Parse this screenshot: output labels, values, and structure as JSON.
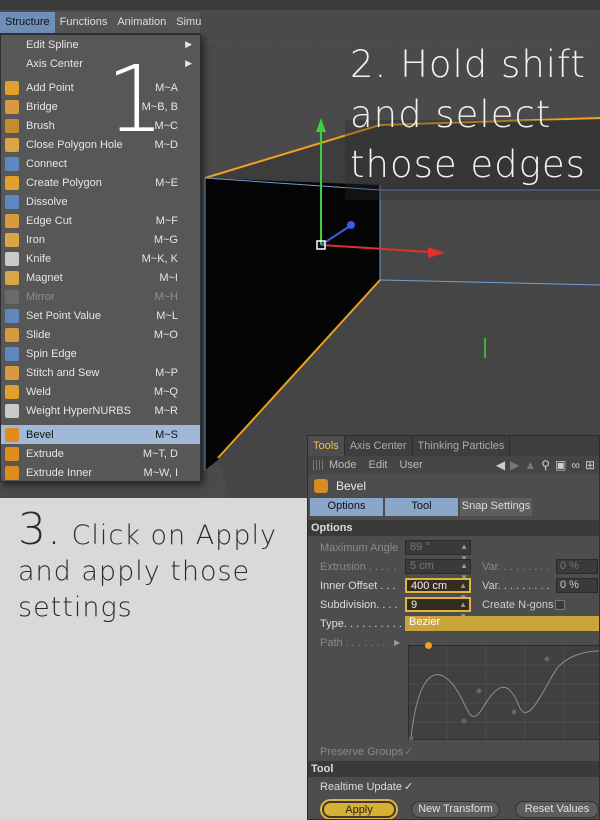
{
  "overlays": {
    "step1": "1",
    "step2": "2. Hold shift and select those edges",
    "step3_num": "3.",
    "step3_text": "Click on Apply and apply those settings"
  },
  "menubar": {
    "items": [
      "Structure",
      "Functions",
      "Animation",
      "Simu"
    ]
  },
  "menu": {
    "items": [
      {
        "label": "Edit Spline",
        "shortcut": "",
        "submenu": true
      },
      {
        "label": "Axis Center",
        "shortcut": "",
        "submenu": true
      },
      {
        "label": "Add Point",
        "shortcut": "M~A"
      },
      {
        "label": "Bridge",
        "shortcut": "M~B, B"
      },
      {
        "label": "Brush",
        "shortcut": "M~C"
      },
      {
        "label": "Close Polygon Hole",
        "shortcut": "M~D"
      },
      {
        "label": "Connect",
        "shortcut": ""
      },
      {
        "label": "Create Polygon",
        "shortcut": "M~E"
      },
      {
        "label": "Dissolve",
        "shortcut": ""
      },
      {
        "label": "Edge Cut",
        "shortcut": "M~F"
      },
      {
        "label": "Iron",
        "shortcut": "M~G"
      },
      {
        "label": "Knife",
        "shortcut": "M~K, K"
      },
      {
        "label": "Magnet",
        "shortcut": "M~I"
      },
      {
        "label": "Mirror",
        "shortcut": "M~H",
        "disabled": true
      },
      {
        "label": "Set Point Value",
        "shortcut": "M~L"
      },
      {
        "label": "Slide",
        "shortcut": "M~O"
      },
      {
        "label": "Spin Edge",
        "shortcut": ""
      },
      {
        "label": "Stitch and Sew",
        "shortcut": "M~P"
      },
      {
        "label": "Weld",
        "shortcut": "M~Q"
      },
      {
        "label": "Weight HyperNURBS",
        "shortcut": "M~R"
      },
      {
        "label": "Bevel",
        "shortcut": "M~S",
        "selected": true
      },
      {
        "label": "Extrude",
        "shortcut": "M~T, D"
      },
      {
        "label": "Extrude Inner",
        "shortcut": "M~W, I"
      }
    ]
  },
  "panel": {
    "tabs": [
      "Tools",
      "Axis Center",
      "Thinking Particles"
    ],
    "menu": [
      "Mode",
      "Edit",
      "User"
    ],
    "tool_title": "Bevel",
    "subtabs": [
      "Options",
      "Tool",
      "Snap Settings"
    ],
    "options_header": "Options",
    "max_angle_label": "Maximum Angle",
    "max_angle_value": "89 °",
    "extrusion_label": "Extrusion . . . . .",
    "extrusion_value": "5 cm",
    "var_label1": "Var. . . . . . . . .",
    "var_value1": "0 %",
    "inner_offset_label": "Inner Offset . . .",
    "inner_offset_value": "400 cm",
    "var_label2": "Var. . . . . . . . .",
    "var_value2": "0 %",
    "subdivision_label": "Subdivision. . . .",
    "subdivision_value": "9",
    "create_ngons_label": "Create N-gons",
    "type_label": "Type. . . . . . . . . .",
    "type_value": "Bezier",
    "path_label": "Path . . . . . . .",
    "preserve_groups_label": "Preserve Groups",
    "tool_header": "Tool",
    "realtime_update_label": "Realtime Update",
    "apply_label": "Apply",
    "new_transform_label": "New Transform",
    "reset_values_label": "Reset Values"
  },
  "colors": {
    "accent_highlight": "#e0b43a",
    "selection_blue": "#9fb9d6",
    "edge_orange": "#f0a020"
  }
}
